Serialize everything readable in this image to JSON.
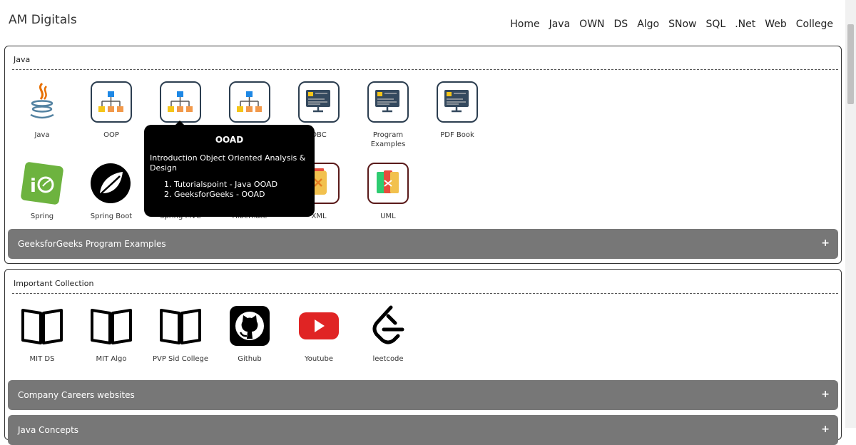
{
  "header": {
    "brand": "AM Digitals",
    "nav": [
      "Home",
      "Java",
      "OWN",
      "DS",
      "Algo",
      "SNow",
      "SQL",
      ".Net",
      "Web",
      "College"
    ]
  },
  "java_section": {
    "title": "Java",
    "tiles": [
      {
        "label": "Java",
        "icon": "java-icon"
      },
      {
        "label": "OOP",
        "icon": "hierarchy-icon"
      },
      {
        "label": "",
        "icon": "hierarchy-icon"
      },
      {
        "label": "",
        "icon": "hierarchy-icon"
      },
      {
        "label": "DBC",
        "icon": "code-monitor-icon"
      },
      {
        "label": "Program Examples",
        "icon": "code-monitor-icon"
      },
      {
        "label": "PDF Book",
        "icon": "code-monitor-icon"
      },
      {
        "label": "Spring",
        "icon": "spring-icon"
      },
      {
        "label": "Spring Boot",
        "icon": "spring-boot-icon"
      },
      {
        "label": "Spring MVC",
        "icon": "spring-mvc-icon"
      },
      {
        "label": "Hibernate",
        "icon": "hibernate-icon"
      },
      {
        "label": "XML",
        "icon": "xml-icon"
      },
      {
        "label": "UML",
        "icon": "uml-icon"
      }
    ],
    "accordion": "GeeksforGeeks Program Examples"
  },
  "collection_section": {
    "title": "Important Collection",
    "tiles": [
      {
        "label": "MIT DS",
        "icon": "book-icon"
      },
      {
        "label": "MIT Algo",
        "icon": "book-icon"
      },
      {
        "label": "PVP Sid College",
        "icon": "book-icon"
      },
      {
        "label": "Github",
        "icon": "github-icon"
      },
      {
        "label": "Youtube",
        "icon": "youtube-icon"
      },
      {
        "label": "leetcode",
        "icon": "leetcode-icon"
      }
    ],
    "accordion": "Company Careers websites",
    "accordion2": "Java Concepts"
  },
  "accordion_symbol": "+",
  "tooltip": {
    "title": "OOAD",
    "description": "Introduction Object Oriented Analysis & Design",
    "links": [
      "Tutorialspoint - Java OOAD",
      "GeeksforGeeks - OOAD"
    ]
  },
  "colors": {
    "accordion": "#777777",
    "tooltip": "#000000",
    "hierarchy_blue": "#1e88e5",
    "hierarchy_orange": "#f2994a",
    "hierarchy_yellow": "#f5c518"
  }
}
